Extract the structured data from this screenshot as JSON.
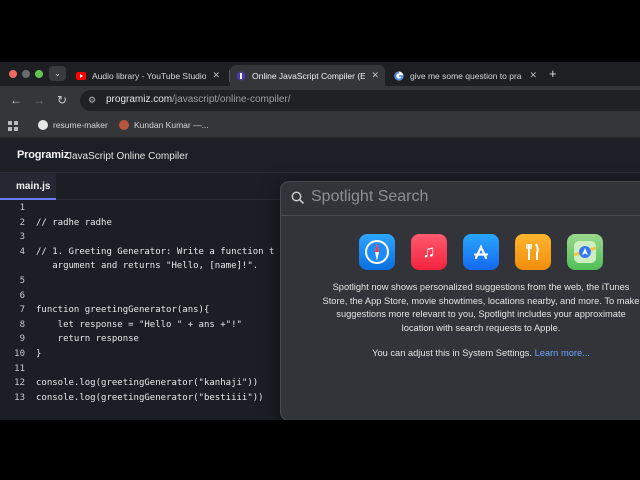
{
  "browser": {
    "tabs": [
      {
        "title": "Audio library - YouTube Studio",
        "active": false,
        "favicon": "youtube-icon"
      },
      {
        "title": "Online JavaScript Compiler (E",
        "active": true,
        "favicon": "programiz-icon"
      },
      {
        "title": "give me some question to pra",
        "active": false,
        "favicon": "google-icon"
      }
    ],
    "url_domain": "programiz.com",
    "url_path": "/javascript/online-compiler/",
    "bookmarks": [
      {
        "label": "resume-maker",
        "icon": "github-icon"
      },
      {
        "label": "Kundan Kumar —...",
        "icon": "profile-icon"
      }
    ]
  },
  "site": {
    "logo": "Programiz",
    "title": "JavaScript Online Compiler"
  },
  "editor": {
    "file_tab": "main.js",
    "lines": [
      {
        "n": "1",
        "code": ""
      },
      {
        "n": "2",
        "code": "// radhe radhe"
      },
      {
        "n": "3",
        "code": ""
      },
      {
        "n": "4",
        "code": "// 1. Greeting Generator: Write a function t"
      },
      {
        "n": "",
        "code": "   argument and returns \"Hello, [name]!\"."
      },
      {
        "n": "5",
        "code": ""
      },
      {
        "n": "6",
        "code": ""
      },
      {
        "n": "7",
        "code": "function greetingGenerator(ans){"
      },
      {
        "n": "8",
        "code": "    let response = \"Hello \" + ans +\"!\""
      },
      {
        "n": "9",
        "code": "    return response"
      },
      {
        "n": "10",
        "code": "}"
      },
      {
        "n": "11",
        "code": ""
      },
      {
        "n": "12",
        "code": "console.log(greetingGenerator(\"kanhaji\"))"
      },
      {
        "n": "13",
        "code": "console.log(greetingGenerator(\"bestiiii\"))"
      }
    ]
  },
  "spotlight": {
    "placeholder": "Spotlight Search",
    "apps": [
      {
        "name": "safari-icon",
        "color": "#1a8cff",
        "glyph": "✦"
      },
      {
        "name": "music-icon",
        "color": "#fa2d48",
        "glyph": "♫"
      },
      {
        "name": "app-store-icon",
        "color": "#1c8ef5",
        "glyph": "A"
      },
      {
        "name": "food-icon",
        "color": "#f7a41b",
        "glyph": "🍴"
      },
      {
        "name": "maps-icon",
        "color": "#5bc85b",
        "glyph": "➤"
      }
    ],
    "message": "Spotlight now shows personalized suggestions from the web, the iTunes Store, the App Store, movie showtimes, locations nearby, and more. To make suggestions more relevant to you, Spotlight includes your approximate location with search requests to Apple.",
    "settings_text": "You can adjust this in System Settings.",
    "learn_more": "Learn more..."
  }
}
